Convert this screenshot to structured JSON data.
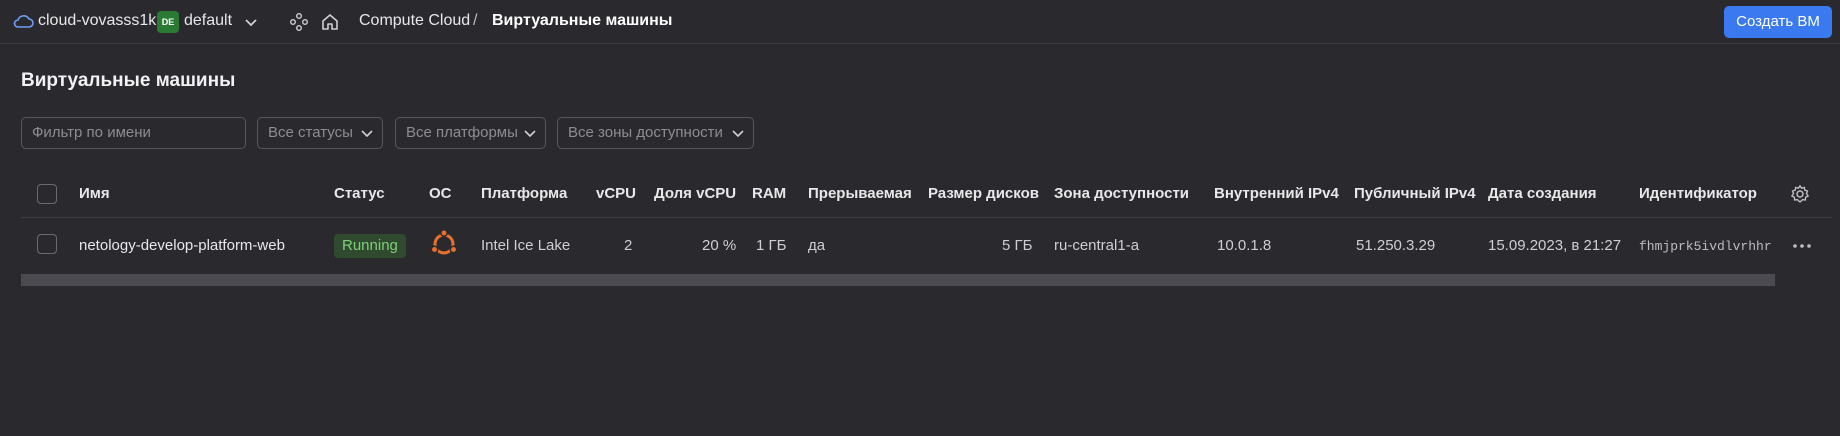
{
  "header": {
    "cloud_name": "cloud-vovasss1k",
    "folder_badge": "DE",
    "folder_name": "default",
    "breadcrumb_service": "Compute Cloud",
    "breadcrumb_separator": "/",
    "breadcrumb_current": "Виртуальные машины",
    "create_button": "Создать ВМ",
    "accent_color": "#3a79f0"
  },
  "page": {
    "title": "Виртуальные машины"
  },
  "filters": {
    "name_placeholder": "Фильтр по имени",
    "status_select": "Все статусы",
    "platform_select": "Все платформы",
    "zone_select": "Все зоны доступности"
  },
  "table": {
    "columns": {
      "name": "Имя",
      "status": "Статус",
      "os": "ОС",
      "platform": "Платформа",
      "vcpu": "vCPU",
      "vcpu_share": "Доля vCPU",
      "ram": "RAM",
      "preemptible": "Прерываемая",
      "disk_size": "Размер дисков",
      "zone": "Зона доступности",
      "internal_ip": "Внутренний IPv4",
      "public_ip": "Публичный IPv4",
      "created": "Дата создания",
      "id": "Идентификатор"
    },
    "rows": [
      {
        "name": "netology-develop-platform-web",
        "status": "Running",
        "os_icon": "ubuntu-icon",
        "platform": "Intel Ice Lake",
        "vcpu": "2",
        "vcpu_share": "20 %",
        "ram": "1 ГБ",
        "preemptible": "да",
        "disk_size": "5 ГБ",
        "zone": "ru-central1-a",
        "internal_ip": "10.0.1.8",
        "public_ip": "51.250.3.29",
        "created": "15.09.2023, в 21:27",
        "id": "fhmjprk5ivdlvrhhr"
      }
    ]
  }
}
